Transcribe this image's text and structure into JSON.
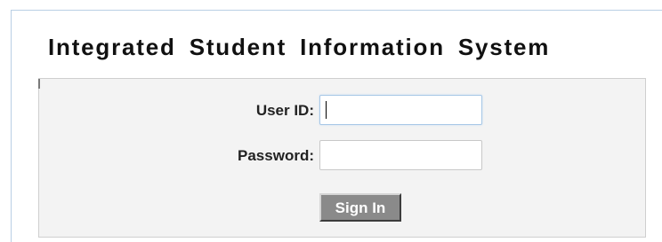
{
  "header": {
    "title": "Integrated Student Information System"
  },
  "login_form": {
    "user_id_label": "User ID:",
    "user_id_value": "",
    "password_label": "Password:",
    "password_value": "",
    "sign_in_label": "Sign In"
  },
  "colors": {
    "panel_background": "#f3f3f3",
    "button_background": "#8a8a8a",
    "focus_border": "#a7c7e6"
  }
}
